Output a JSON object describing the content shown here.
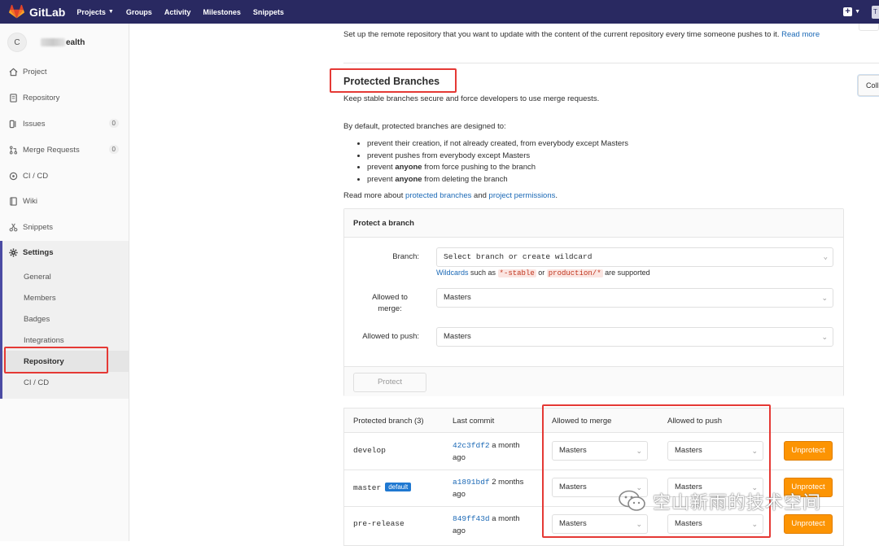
{
  "navbar": {
    "brand": "GitLab",
    "items": [
      {
        "label": "Projects",
        "has_caret": true
      },
      {
        "label": "Groups"
      },
      {
        "label": "Activity"
      },
      {
        "label": "Milestones"
      },
      {
        "label": "Snippets"
      }
    ],
    "bg_color": "#292961",
    "user_initial": "T"
  },
  "sidebar": {
    "project_avatar": "C",
    "project_name_suffix": "ealth",
    "items": [
      {
        "label": "Project",
        "icon": "home-icon"
      },
      {
        "label": "Repository",
        "icon": "doc-icon"
      },
      {
        "label": "Issues",
        "icon": "issues-icon",
        "count": "0"
      },
      {
        "label": "Merge Requests",
        "icon": "merge-icon",
        "count": "0"
      },
      {
        "label": "CI / CD",
        "icon": "rocket-icon"
      },
      {
        "label": "Wiki",
        "icon": "book-icon"
      },
      {
        "label": "Snippets",
        "icon": "scissors-icon"
      }
    ],
    "settings": {
      "label": "Settings",
      "sub_items": [
        "General",
        "Members",
        "Badges",
        "Integrations",
        "Repository",
        "CI / CD"
      ],
      "active": "Repository"
    }
  },
  "content": {
    "top_description": "Set up the remote repository that you want to update with the content of the current repository every time someone pushes to it.",
    "top_read_more": "Read more",
    "section_title": "Protected Branches",
    "collapse_label": "Coll",
    "section_subtitle": "Keep stable branches secure and force developers to use merge requests.",
    "default_intro": "By default, protected branches are designed to:",
    "bullets": [
      {
        "pre": "prevent their creation, if not already created, from everybody except Masters",
        "bold": "",
        "post": ""
      },
      {
        "pre": "prevent pushes from everybody except Masters",
        "bold": "",
        "post": ""
      },
      {
        "pre": "prevent ",
        "bold": "anyone",
        "post": " from force pushing to the branch"
      },
      {
        "pre": "prevent ",
        "bold": "anyone",
        "post": " from deleting the branch"
      }
    ],
    "read_more": {
      "prefix": "Read more about ",
      "link1": "protected branches",
      "middle": " and ",
      "link2": "project permissions",
      "suffix": "."
    }
  },
  "protect_form": {
    "title": "Protect a branch",
    "branch_label": "Branch:",
    "branch_placeholder": "Select branch or create wildcard",
    "wildcard_help": {
      "link": "Wildcards",
      "text1": " such as ",
      "code1": "*-stable",
      "text2": " or ",
      "code2": "production/*",
      "text3": " are supported"
    },
    "merge_label_1": "Allowed to",
    "merge_label_2": "merge:",
    "merge_value": "Masters",
    "push_label": "Allowed to push:",
    "push_value": "Masters",
    "protect_button": "Protect"
  },
  "branches_table": {
    "headers": {
      "branch": "Protected branch (3)",
      "commit": "Last commit",
      "merge": "Allowed to merge",
      "push": "Allowed to push"
    },
    "rows": [
      {
        "name": "develop",
        "default": "",
        "sha": "42c3fdf2",
        "ago_1": " a month",
        "ago_2": "ago",
        "merge": "Masters",
        "push": "Masters",
        "action": "Unprotect"
      },
      {
        "name": "master",
        "default": "default",
        "sha": "a1891bdf",
        "ago_1": " 2 months",
        "ago_2": "ago",
        "merge": "Masters",
        "push": "Masters",
        "action": "Unprotect"
      },
      {
        "name": "pre-release",
        "default": "",
        "sha": "849ff43d",
        "ago_1": " a month",
        "ago_2": "ago",
        "merge": "Masters",
        "push": "Masters",
        "action": "Unprotect"
      }
    ]
  },
  "watermark": "空山新雨的技术空间",
  "colors": {
    "accent_link": "#1b69b6",
    "unprotect": "#fc9403",
    "highlight": "#e53935",
    "badge": "#1f78d1"
  }
}
